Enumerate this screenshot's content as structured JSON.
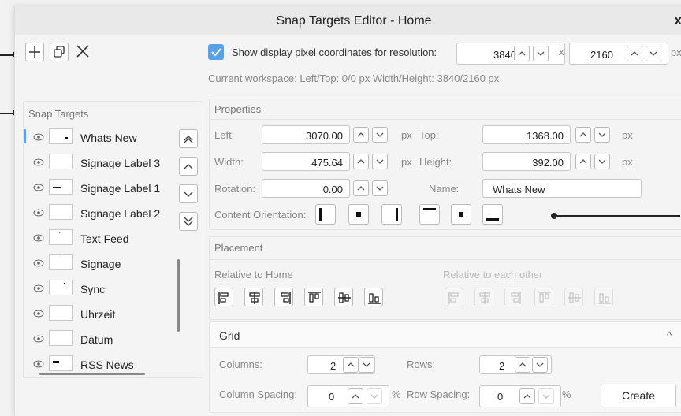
{
  "window": {
    "title": "Snap Targets Editor - Home",
    "close_glyph": "x"
  },
  "toolbar": {
    "icons": [
      "plus-icon",
      "copy-icon",
      "close-icon"
    ]
  },
  "display": {
    "show_pixel_label": "Show display pixel coordinates for resolution:",
    "checked": true,
    "res_width": "3840",
    "times": "x",
    "res_height": "2160",
    "unit": "px",
    "workspace_info": "Current workspace: Left/Top: 0/0 px Width/Height: 3840/2160 px"
  },
  "snap_targets": {
    "title": "Snap Targets",
    "items": [
      {
        "label": "Whats New",
        "selected": true
      },
      {
        "label": "Signage Label 3"
      },
      {
        "label": "Signage Label 1"
      },
      {
        "label": "Signage Label 2"
      },
      {
        "label": "Text Feed"
      },
      {
        "label": "Signage"
      },
      {
        "label": "Sync"
      },
      {
        "label": "Uhrzeit"
      },
      {
        "label": "Datum"
      },
      {
        "label": "RSS News"
      }
    ]
  },
  "properties": {
    "title": "Properties",
    "left_label": "Left:",
    "left_value": "3070.00",
    "top_label": "Top:",
    "top_value": "1368.00",
    "width_label": "Width:",
    "width_value": "475.64",
    "height_label": "Height:",
    "height_value": "392.00",
    "rotation_label": "Rotation:",
    "rotation_value": "0.00",
    "name_label": "Name:",
    "name_value": "Whats New",
    "px": "px",
    "orientation_label": "Content Orientation:"
  },
  "placement": {
    "title": "Placement",
    "relative_home": "Relative to Home",
    "relative_each": "Relative to each other"
  },
  "grid": {
    "title": "Grid",
    "collapse_glyph": "^",
    "columns_label": "Columns:",
    "columns_value": "2",
    "rows_label": "Rows:",
    "rows_value": "2",
    "col_spacing_label": "Column Spacing:",
    "col_spacing_value": "0",
    "percent": "%",
    "row_spacing_label": "Row Spacing:",
    "row_spacing_value": "0",
    "create_label": "Create"
  },
  "colors": {
    "accent": "#5aa0e6",
    "callout": "#222222"
  }
}
